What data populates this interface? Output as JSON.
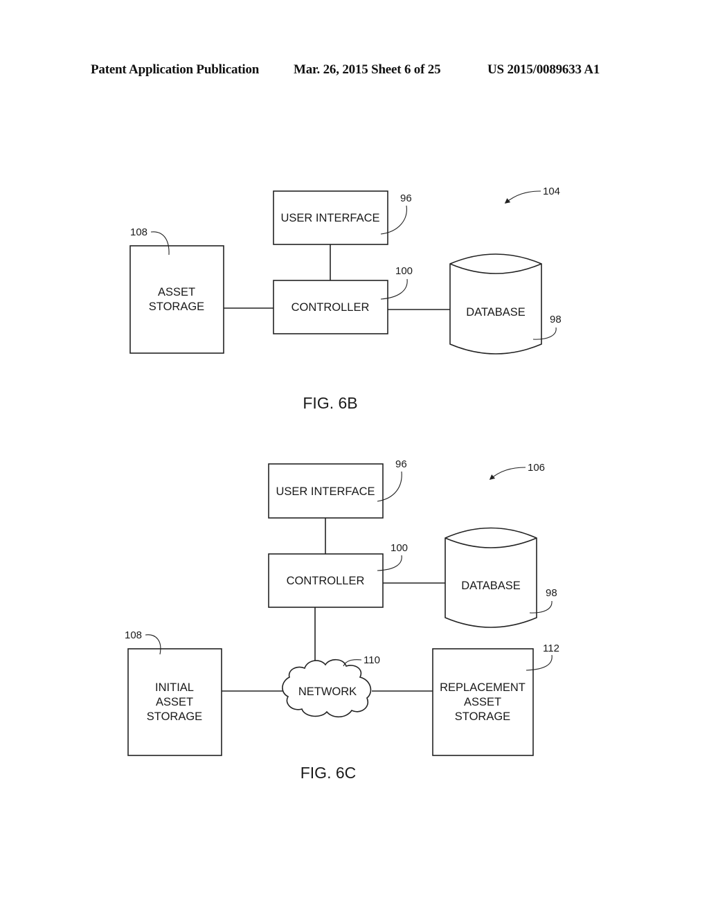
{
  "header": {
    "publication": "Patent Application Publication",
    "date_sheet": "Mar. 26, 2015  Sheet 6 of 25",
    "number": "US 2015/0089633 A1"
  },
  "fig6b": {
    "caption": "FIG. 6B",
    "system_ref": "104",
    "user_interface": {
      "label": "USER INTERFACE",
      "ref": "96"
    },
    "controller": {
      "label": "CONTROLLER",
      "ref": "100"
    },
    "database": {
      "label": "DATABASE",
      "ref": "98"
    },
    "asset_storage": {
      "lines": [
        "ASSET",
        "STORAGE"
      ],
      "ref": "108"
    }
  },
  "fig6c": {
    "caption": "FIG. 6C",
    "system_ref": "106",
    "user_interface": {
      "label": "USER INTERFACE",
      "ref": "96"
    },
    "controller": {
      "label": "CONTROLLER",
      "ref": "100"
    },
    "database": {
      "label": "DATABASE",
      "ref": "98"
    },
    "network": {
      "label": "NETWORK",
      "ref": "110"
    },
    "initial_storage": {
      "lines": [
        "INITIAL",
        "ASSET",
        "STORAGE"
      ],
      "ref": "108"
    },
    "replacement_storage": {
      "lines": [
        "REPLACEMENT",
        "ASSET",
        "STORAGE"
      ],
      "ref": "112"
    }
  }
}
